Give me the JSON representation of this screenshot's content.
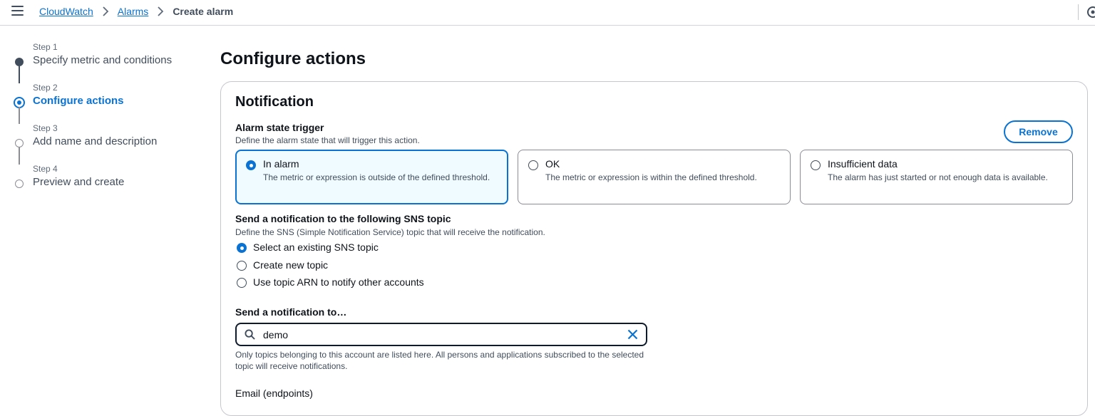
{
  "breadcrumb": [
    "CloudWatch",
    "Alarms",
    "Create alarm"
  ],
  "steps": [
    {
      "number": "Step 1",
      "title": "Specify metric and conditions",
      "state": "done"
    },
    {
      "number": "Step 2",
      "title": "Configure actions",
      "state": "current"
    },
    {
      "number": "Step 3",
      "title": "Add name and description",
      "state": "todo"
    },
    {
      "number": "Step 4",
      "title": "Preview and create",
      "state": "todo"
    }
  ],
  "page_title": "Configure actions",
  "notification": {
    "title": "Notification",
    "remove_label": "Remove",
    "trigger": {
      "label": "Alarm state trigger",
      "description": "Define the alarm state that will trigger this action.",
      "options": [
        {
          "label": "In alarm",
          "description": "The metric or expression is outside of the defined threshold.",
          "selected": true
        },
        {
          "label": "OK",
          "description": "The metric or expression is within the defined threshold.",
          "selected": false
        },
        {
          "label": "Insufficient data",
          "description": "The alarm has just started or not enough data is available.",
          "selected": false
        }
      ]
    },
    "sns": {
      "label": "Send a notification to the following SNS topic",
      "description": "Define the SNS (Simple Notification Service) topic that will receive the notification.",
      "options": [
        {
          "label": "Select an existing SNS topic",
          "selected": true
        },
        {
          "label": "Create new topic",
          "selected": false
        },
        {
          "label": "Use topic ARN to notify other accounts",
          "selected": false
        }
      ]
    },
    "send_to": {
      "label": "Send a notification to…",
      "value": "demo",
      "help": "Only topics belonging to this account are listed here. All persons and applications subscribed to the selected topic will receive notifications."
    },
    "email_label": "Email (endpoints)"
  },
  "colors": {
    "accent": "#0972d3",
    "selected_tile_bg": "#f0fbff",
    "text": "#0f141a"
  },
  "icons": [
    "menu-icon",
    "chevron-right-icon",
    "search-icon",
    "close-icon",
    "settings-icon"
  ]
}
